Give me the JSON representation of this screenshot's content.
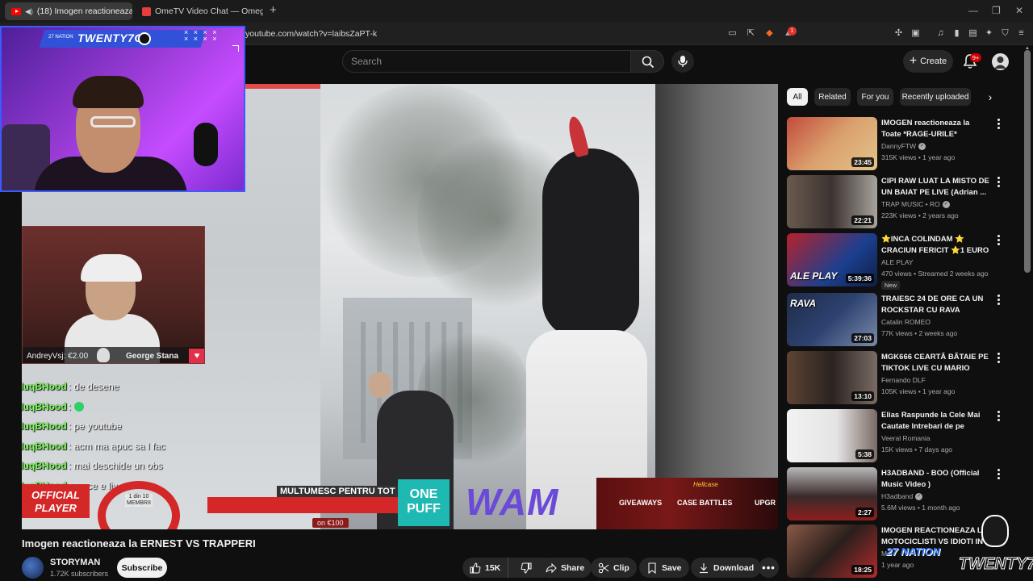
{
  "browser": {
    "tabs": [
      {
        "label": "(18) Imogen reactioneaza la E",
        "active": true
      },
      {
        "label": "OmeTV Video Chat — Omegle R",
        "active": false
      }
    ],
    "url": "youtube.com/watch?v=laibsZaPT-k",
    "brave_badge": "1"
  },
  "header": {
    "search_placeholder": "Search",
    "create_label": "Create",
    "notifications_badge": "9+"
  },
  "stream_overlay": {
    "banner_small": "27 NATION",
    "banner_title": "TWENTY7G",
    "banner_marks": "× × × ×\n× × × ×",
    "donor_line": "AndreyVsj: €2.00",
    "guest_name": "George Stana",
    "chat": [
      {
        "user": "RaduqBHood",
        "message": ": de desene"
      },
      {
        "user": "RaduqBHood",
        "message": ":"
      },
      {
        "user": "RaduqBHood",
        "message": ": pe youtube"
      },
      {
        "user": "RaduqBHood",
        "message": ": acm ma apuc sa l fac"
      },
      {
        "user": "RaduqBHood",
        "message": ": mai deschide un obs"
      },
      {
        "user": "RaduqBHood",
        "message": ": pe ce e live ?"
      }
    ],
    "official_player": "OFFICIAL\nPLAYER",
    "arc_label": "1 din 10\nMEMBRII",
    "thanks": "MULTUMESC PENTRU TOT <3",
    "cost": "on €100",
    "one_puff": "ONE\nPUFF",
    "wam": "WAM",
    "promo_brand": "Hellcase",
    "promo_items": [
      "GIVEAWAYS",
      "CASE BATTLES",
      "UPGR"
    ]
  },
  "video": {
    "title": "Imogen reactioneaza la ERNEST VS TRAPPERI",
    "channel": "STORYMAN",
    "subscribers": "1.72K subscribers",
    "subscribe_label": "Subscribe",
    "likes": "15K",
    "share_label": "Share",
    "clip_label": "Clip",
    "save_label": "Save",
    "download_label": "Download"
  },
  "chips": [
    "All",
    "Related",
    "For you",
    "Recently uploaded"
  ],
  "recommendations": [
    {
      "title": "IMOGEN reactioneaza la Toate *RAGE-URILE* YouTuberilor ...",
      "channel": "DannyFTW",
      "verified": true,
      "meta": "315K views • 1 year ago",
      "duration": "23:45",
      "badge": "",
      "thumb_text": ""
    },
    {
      "title": "CIPI RAW LUAT LA MISTO DE UN BAIAT PE LIVE (Adrian ...",
      "channel": "TRAP MUSIC • RO",
      "verified": true,
      "meta": "223K views • 2 years ago",
      "duration": "22:21",
      "badge": "",
      "thumb_text": ""
    },
    {
      "title": "⭐INCA COLINDAM ⭐ CRACIUN FERICIT ⭐1 EURO ...",
      "channel": "ALE PLAY",
      "verified": false,
      "meta": "470 views • Streamed 2 weeks ago",
      "duration": "5:39:36",
      "badge": "New",
      "thumb_text": "ALE PLAY"
    },
    {
      "title": "TRAIESC 24 DE ORE CA UN ROCKSTAR CU RAVA",
      "channel": "Catalin ROMEO",
      "verified": false,
      "meta": "77K views • 2 weeks ago",
      "duration": "27:03",
      "badge": "",
      "thumb_text": "RAVA"
    },
    {
      "title": "MGK666 CEARTĂ BĂTAIE PE TIKTOK LIVE CU MARIO STAN ...",
      "channel": "Fernando DLF",
      "verified": false,
      "meta": "105K views • 1 year ago",
      "duration": "13:10",
      "badge": "",
      "thumb_text": ""
    },
    {
      "title": "Elias Raspunde la Cele Mai Cautate Intrebari de pe Internet",
      "channel": "Veeral Romania",
      "verified": false,
      "meta": "15K views • 7 days ago",
      "duration": "5:38",
      "badge": "",
      "thumb_text": ""
    },
    {
      "title": "H3ADBAND - BOO (Official Music Video )",
      "channel": "H3adband",
      "verified": true,
      "meta": "5.6M views • 1 month ago",
      "duration": "2:27",
      "badge": "",
      "thumb_text": ""
    },
    {
      "title": "IMOGEN REACTIONEAZA LA MOTOCICLISTI VS IDIOTI IN ...",
      "channel": "Mor",
      "verified": false,
      "meta": "1 year ago",
      "duration": "18:25",
      "badge": "",
      "thumb_text": ""
    }
  ],
  "watermark": {
    "nation": "27 NATION",
    "name": "TWENTY7G"
  },
  "colors": {
    "background": "#0f0f0f",
    "accent_red": "#ff0000",
    "chat_user": "#7dff5a",
    "overlay_blue": "#3152d8"
  }
}
